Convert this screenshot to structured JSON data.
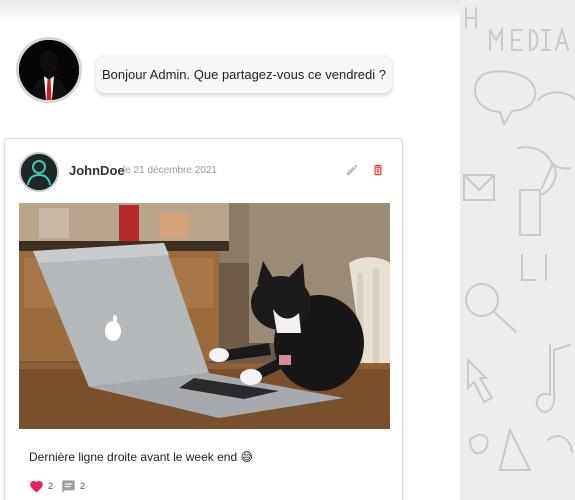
{
  "greeting": {
    "text": "Bonjour Admin. Que partagez-vous ce vendredi ?"
  },
  "post": {
    "author": "JohnDoe",
    "date": "le 21 décembre 2021",
    "text": "Dernière ligne droite avant le week end 😅",
    "likes": "2",
    "comments": "2"
  },
  "icons": {
    "edit": "pencil-icon",
    "delete": "trash-icon",
    "like": "heart-icon",
    "comment": "comment-icon"
  },
  "colors": {
    "delete": "#e53935",
    "like": "#e91e63",
    "edit": "#bdbdbd",
    "comment": "#9e9e9e"
  }
}
